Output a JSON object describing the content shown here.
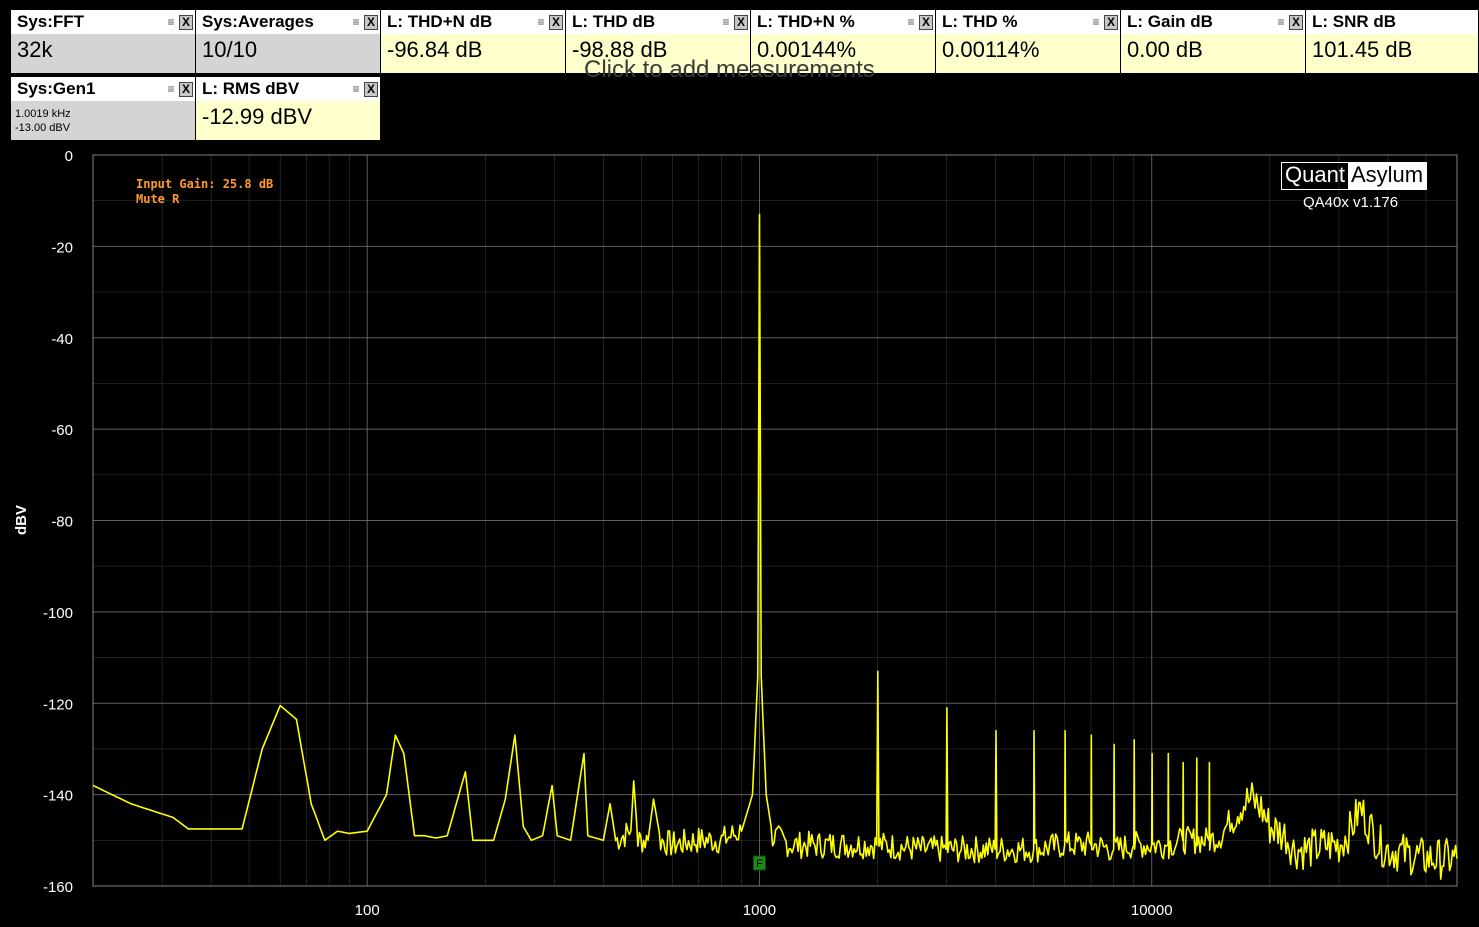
{
  "tiles": [
    {
      "title": "Sys:FFT",
      "value": "32k",
      "kind": "sys"
    },
    {
      "title": "Sys:Averages",
      "value": "10/10",
      "kind": "sys"
    },
    {
      "title": "L: THD+N dB",
      "value": "-96.84 dB",
      "kind": "meas"
    },
    {
      "title": "L: THD dB",
      "value": "-98.88 dB",
      "kind": "meas"
    },
    {
      "title": "L: THD+N %",
      "value": "0.00144%",
      "kind": "meas"
    },
    {
      "title": "L: THD %",
      "value": "0.00114%",
      "kind": "meas"
    },
    {
      "title": "L: Gain dB",
      "value": "0.00 dB",
      "kind": "meas"
    },
    {
      "title": "L: SNR dB",
      "value": "101.45 dB",
      "kind": "meas"
    }
  ],
  "gen": {
    "title": "Sys:Gen1",
    "freq": "1.0019 kHz",
    "level": "-13.00 dBV"
  },
  "rms": {
    "title": "L: RMS dBV",
    "value": "-12.99 dBV"
  },
  "ghost_text": "Click to add measurements",
  "annotations": {
    "gain": "Input Gain: 25.8 dB",
    "mute": "Mute R"
  },
  "logo": {
    "part1": "Quant",
    "part2": "Asylum",
    "version": "QA40x v1.176"
  },
  "marker_label": "F",
  "colors": {
    "trace": "#ffff00",
    "grid": "#808080",
    "background": "#000000",
    "annotation": "#ff9a2e",
    "marker": "#1a8a1a"
  },
  "chart_data": {
    "type": "line",
    "title": "",
    "xlabel": "",
    "ylabel": "dBV",
    "x_scale": "log",
    "xlim": [
      20,
      60000
    ],
    "ylim": [
      -160,
      0
    ],
    "x_ticks": [
      100,
      1000,
      10000
    ],
    "y_ticks": [
      0,
      -20,
      -40,
      -60,
      -80,
      -100,
      -120,
      -140,
      -160
    ],
    "grid": true,
    "series": [
      {
        "values": [
          [
            20,
            -138
          ],
          [
            25,
            -142
          ],
          [
            32,
            -145
          ],
          [
            35,
            -147.5
          ],
          [
            40,
            -147.5
          ],
          [
            48,
            -147.5
          ],
          [
            54,
            -130
          ],
          [
            60,
            -120.5
          ],
          [
            66,
            -123.5
          ],
          [
            72,
            -142
          ],
          [
            78,
            -150
          ],
          [
            84,
            -148
          ],
          [
            90,
            -148.5
          ],
          [
            100,
            -148
          ],
          [
            112,
            -140
          ],
          [
            118,
            -127
          ],
          [
            124,
            -131
          ],
          [
            132,
            -149
          ],
          [
            140,
            -149
          ],
          [
            150,
            -149.5
          ],
          [
            160,
            -149
          ],
          [
            170,
            -141
          ],
          [
            178,
            -135
          ],
          [
            186,
            -150
          ],
          [
            210,
            -150
          ],
          [
            225,
            -141
          ],
          [
            238,
            -127
          ],
          [
            250,
            -147
          ],
          [
            262,
            -150
          ],
          [
            280,
            -149
          ],
          [
            296,
            -138
          ],
          [
            305,
            -149
          ],
          [
            330,
            -150
          ],
          [
            357,
            -131
          ],
          [
            365,
            -149
          ],
          [
            400,
            -150
          ],
          [
            416,
            -142
          ],
          [
            430,
            -150
          ],
          [
            470,
            -148
          ],
          [
            478,
            -137
          ],
          [
            490,
            -150
          ],
          [
            520,
            -150
          ],
          [
            537,
            -141
          ],
          [
            560,
            -150
          ],
          [
            600,
            -151
          ],
          [
            700,
            -150
          ],
          [
            800,
            -150
          ],
          [
            900,
            -148
          ],
          [
            960,
            -140
          ],
          [
            990,
            -114
          ],
          [
            1000,
            -13
          ],
          [
            1010,
            -114
          ],
          [
            1040,
            -140
          ],
          [
            1080,
            -149
          ],
          [
            1200,
            -151
          ],
          [
            1500,
            -151
          ],
          [
            1990,
            -151
          ],
          [
            2003,
            -113
          ],
          [
            2016,
            -151
          ],
          [
            2600,
            -152
          ],
          [
            2990,
            -152
          ],
          [
            3005,
            -121
          ],
          [
            3020,
            -152
          ],
          [
            3990,
            -152
          ],
          [
            4009,
            -126
          ],
          [
            4030,
            -152
          ],
          [
            5000,
            -152
          ],
          [
            5011,
            -126
          ],
          [
            5030,
            -152
          ],
          [
            6000,
            -151
          ],
          [
            6013,
            -126
          ],
          [
            6030,
            -151
          ],
          [
            7000,
            -151
          ],
          [
            7015,
            -127
          ],
          [
            7030,
            -151
          ],
          [
            8000,
            -152
          ],
          [
            8017,
            -129
          ],
          [
            8035,
            -152
          ],
          [
            9000,
            -151
          ],
          [
            9019,
            -128
          ],
          [
            9040,
            -151
          ],
          [
            10000,
            -151
          ],
          [
            10021,
            -131
          ],
          [
            10040,
            -151
          ],
          [
            11000,
            -151
          ],
          [
            11023,
            -131
          ],
          [
            11045,
            -151
          ],
          [
            12000,
            -150
          ],
          [
            12025,
            -133
          ],
          [
            12050,
            -150
          ],
          [
            13000,
            -150
          ],
          [
            13027,
            -132
          ],
          [
            13050,
            -150
          ],
          [
            14000,
            -150
          ],
          [
            14029,
            -133
          ],
          [
            14050,
            -150
          ],
          [
            15000,
            -149
          ],
          [
            16000,
            -145
          ],
          [
            17000,
            -142
          ],
          [
            18000,
            -141
          ],
          [
            19000,
            -143
          ],
          [
            20000,
            -147
          ],
          [
            21000,
            -148
          ],
          [
            22000,
            -149
          ],
          [
            23000,
            -152
          ],
          [
            25000,
            -152
          ],
          [
            28000,
            -151
          ],
          [
            30000,
            -151
          ],
          [
            32000,
            -148
          ],
          [
            34000,
            -143
          ],
          [
            36000,
            -147
          ],
          [
            38000,
            -151
          ],
          [
            40000,
            -152
          ],
          [
            45000,
            -153
          ],
          [
            50000,
            -154
          ],
          [
            55000,
            -154
          ],
          [
            60000,
            -154
          ]
        ]
      }
    ],
    "markers": [
      {
        "x": 1000,
        "label": "F"
      }
    ]
  }
}
